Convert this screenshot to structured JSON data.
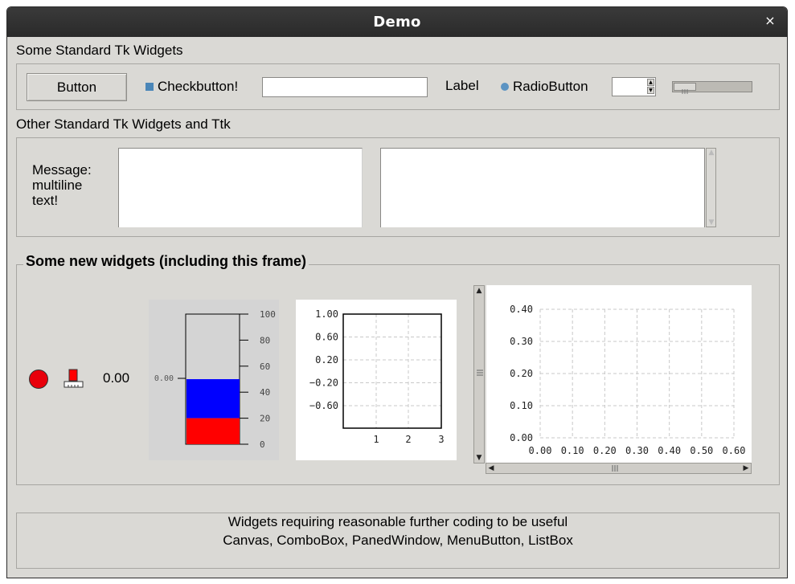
{
  "window": {
    "title": "Demo",
    "close_glyph": "×"
  },
  "frame1": {
    "label": "Some Standard Tk Widgets",
    "button_label": "Button",
    "checkbutton_label": "Checkbutton!",
    "entry_value": "",
    "label_text": "Label",
    "radiobutton_label": "RadioButton",
    "spinbox_value": "",
    "scale_value": 0
  },
  "frame2": {
    "label": "Other Standard Tk Widgets and Ttk",
    "message_lines": [
      "Message:",
      "multiline",
      "text!"
    ],
    "text_value": "",
    "textbox_value": ""
  },
  "frame3": {
    "label": "Some new widgets (including this frame)",
    "led_color": "#e8000b",
    "value_readout": "0.00",
    "meter": {
      "value_label": "0.00",
      "ticks": [
        "100",
        "80",
        "60",
        "40",
        "20",
        "0"
      ],
      "blue_level": 50,
      "red_level": 20,
      "blue_color": "#0000ff",
      "red_color": "#ff0000"
    },
    "plot1": {
      "y_ticks": [
        "1.00",
        "0.60",
        "0.20",
        "−0.20",
        "−0.60"
      ],
      "x_ticks": [
        "1",
        "2",
        "3"
      ]
    },
    "plot2": {
      "y_ticks": [
        "0.40",
        "0.30",
        "0.20",
        "0.10",
        "0.00"
      ],
      "x_ticks": [
        "0.00",
        "0.10",
        "0.20",
        "0.30",
        "0.40",
        "0.50",
        "0.60"
      ]
    }
  },
  "frame4": {
    "line1": "Widgets requiring reasonable further coding to be useful",
    "line2": "Canvas, ComboBox, PanedWindow, MenuButton, ListBox"
  }
}
